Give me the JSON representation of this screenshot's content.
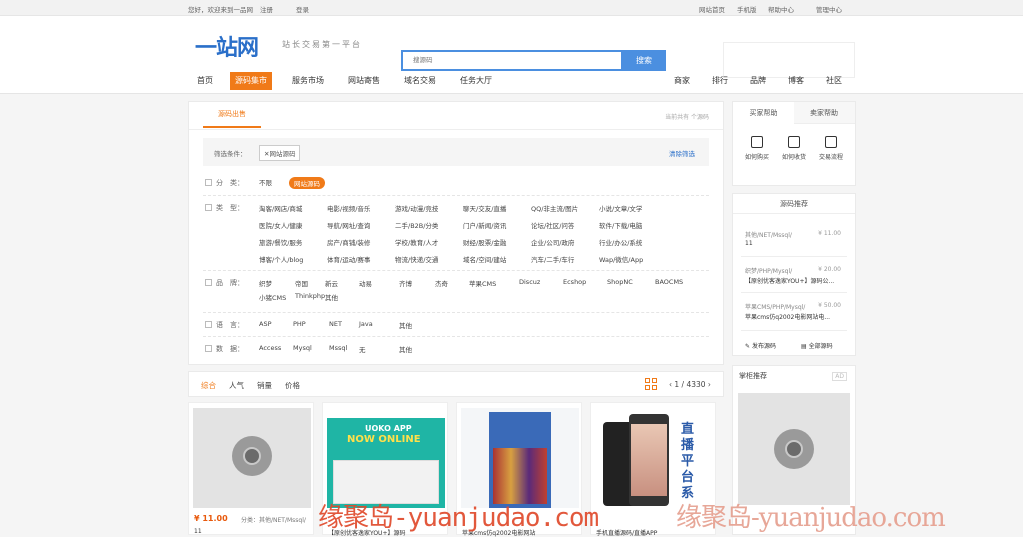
{
  "topbar": {
    "greeting": "您好，欢迎来到一品网",
    "register": "注册",
    "login": "登录",
    "links": [
      "网站首页",
      "手机版",
      "帮助中心",
      "管理中心"
    ]
  },
  "header": {
    "logo": "一站网",
    "slogan": "站长交易第一平台",
    "search_placeholder": "搜源码",
    "search_button": "搜索"
  },
  "nav": {
    "items": [
      "首页",
      "源码集市",
      "服务市场",
      "网站寄售",
      "域名交易",
      "任务大厅"
    ],
    "active": "源码集市",
    "right": [
      "商家",
      "排行",
      "品牌",
      "博客",
      "社区"
    ]
  },
  "main": {
    "tab": "源码出售",
    "stat": "当前共有 个源码",
    "filter": {
      "label": "筛选条件：",
      "chip": "✕网站源码",
      "clear": "清除筛选"
    },
    "rows": [
      {
        "label": "分　类：",
        "options": [
          "不限",
          "网站源码"
        ],
        "active": 1
      },
      {
        "label": "类　型：",
        "options": [
          "淘客/网店/商城",
          "电影/视频/音乐",
          "游戏/动漫/竞技",
          "聊天/交友/直播",
          "QQ/非主流/图片",
          "小说/文章/文学",
          "医院/女人/健康",
          "导航/网址/查询",
          "二手/B2B/分类",
          "门户/新闻/资讯",
          "论坛/社区/问答",
          "软件/下载/电脑",
          "旅游/餐饮/服务",
          "房产/商铺/装修",
          "学校/教育/人才",
          "财经/股票/金融",
          "企业/公司/政府",
          "行业/办公/系统",
          "博客/个人/blog",
          "体育/运动/赛事",
          "物流/快递/交通",
          "域名/空间/建站",
          "汽车/二手/车行",
          "Wap/微信/App"
        ]
      },
      {
        "label": "品　牌：",
        "options": [
          "织梦",
          "帝国",
          "新云",
          "动易",
          "齐博",
          "杰奇",
          "苹果CMS",
          "Discuz",
          "Ecshop",
          "ShopNC",
          "BAOCMS",
          "小猪CMS",
          "Thinkphp",
          "其他"
        ]
      },
      {
        "label": "语　言：",
        "options": [
          "ASP",
          "PHP",
          "NET",
          "Java",
          "其他"
        ]
      },
      {
        "label": "数　据：",
        "options": [
          "Access",
          "Mysql",
          "Mssql",
          "无",
          "其他"
        ]
      }
    ]
  },
  "sort": {
    "items": [
      "综合",
      "人气",
      "销量",
      "价格"
    ],
    "pager": "‹ 1 / 4330 ›"
  },
  "cards": [
    {
      "price": "¥ 11.00",
      "cat": "分类：其他/NET/Mssql/",
      "title": "11"
    },
    {
      "banner_top": "UOKO APP",
      "banner_mid": "NOW ONLINE",
      "title": "【原创优客逸家YOU+】源码"
    },
    {
      "title": "苹果cms仿q2002电影网站"
    },
    {
      "banner": "直播平台系",
      "title": "手机直播源码/直播APP"
    }
  ],
  "sidebar": {
    "tabs": [
      "买家帮助",
      "卖家帮助"
    ],
    "icons": [
      "如何购买",
      "如何收货",
      "交易流程"
    ],
    "rec_title": "源码推荐",
    "rec": [
      {
        "name": "其他/NET/Mssql/",
        "price": "¥ 11.00",
        "title": "11"
      },
      {
        "name": "织梦/PHP/Mysql/",
        "price": "¥ 20.00",
        "title": "【原创优客逸家YOU+】源码公..."
      },
      {
        "name": "苹果CMS/PHP/Mysql/",
        "price": "¥ 50.00",
        "title": "苹果cms仿q2002电影网站电..."
      }
    ],
    "buttons": [
      "发布源码",
      "全部源码"
    ],
    "ad_title": "掌柜推荐",
    "ad_tag": "AD"
  },
  "watermark": {
    "left": "缘聚岛-yuanjudao.com",
    "right": "缘聚岛-yuanjudao.com"
  },
  "colors": {
    "accent": "#f07a18",
    "brand": "#2a6fc9",
    "price": "#e8590c"
  }
}
